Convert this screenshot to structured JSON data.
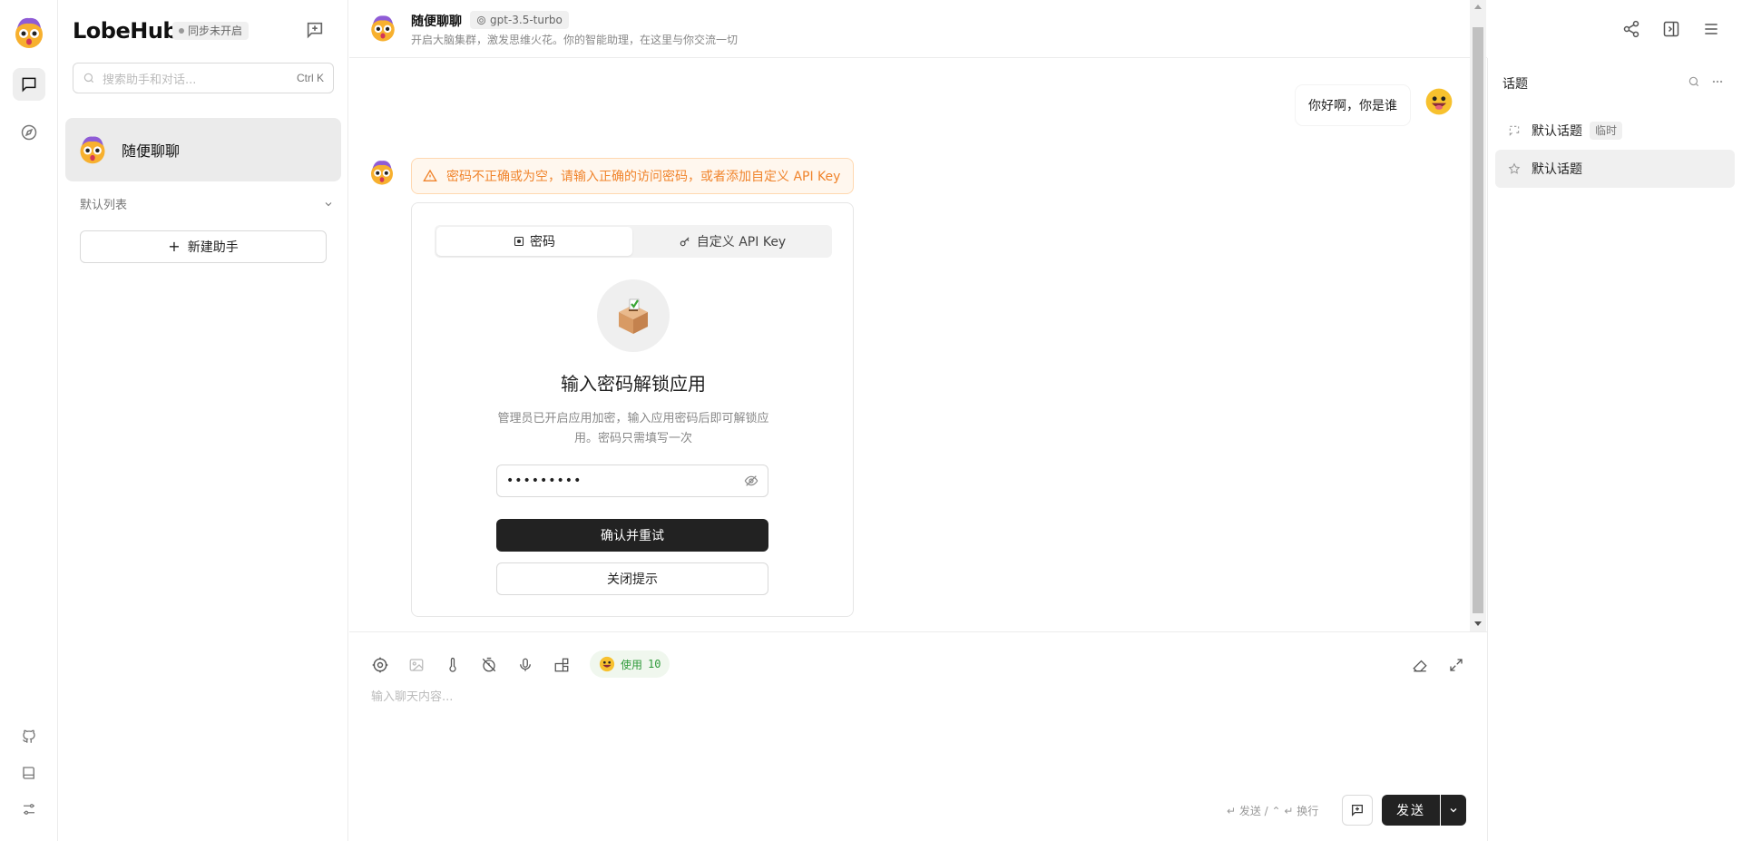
{
  "app": {
    "brand": "LobeHub",
    "sync_status": "同步未开启"
  },
  "sidebar": {
    "search_placeholder": "搜索助手和对话...",
    "search_shortcut": "Ctrl K",
    "sessions": [
      {
        "title": "随便聊聊"
      }
    ],
    "group_title": "默认列表",
    "new_agent_label": "新建助手"
  },
  "chat": {
    "title": "随便聊聊",
    "model": "gpt-3.5-turbo",
    "description": "开启大脑集群，激发思维火花。你的智能助理，在这里与你交流一切",
    "user_message": "你好啊，你是谁",
    "error_alert": "密码不正确或为空，请输入正确的访问密码，或者添加自定义 API Key",
    "auth_tabs": [
      {
        "label": "密码"
      },
      {
        "label": "自定义 API Key"
      }
    ],
    "unlock_title": "输入密码解锁应用",
    "unlock_desc": "管理员已开启应用加密，输入应用密码后即可解锁应用。密码只需填写一次",
    "password_value": "•••••••••",
    "confirm_label": "确认并重试",
    "close_label": "关闭提示"
  },
  "input": {
    "token_label": "使用",
    "token_count": "10",
    "placeholder": "输入聊天内容...",
    "hint": "↵ 发送 / ⌃ ↵ 换行",
    "send_label": "发送"
  },
  "topics": {
    "title": "话题",
    "items": [
      {
        "label": "默认话题",
        "badge": "临时"
      },
      {
        "label": "默认话题"
      }
    ]
  },
  "colors": {
    "accent_dark": "#222222",
    "warning": "#f0842c",
    "token_green": "#2e9a3a"
  }
}
